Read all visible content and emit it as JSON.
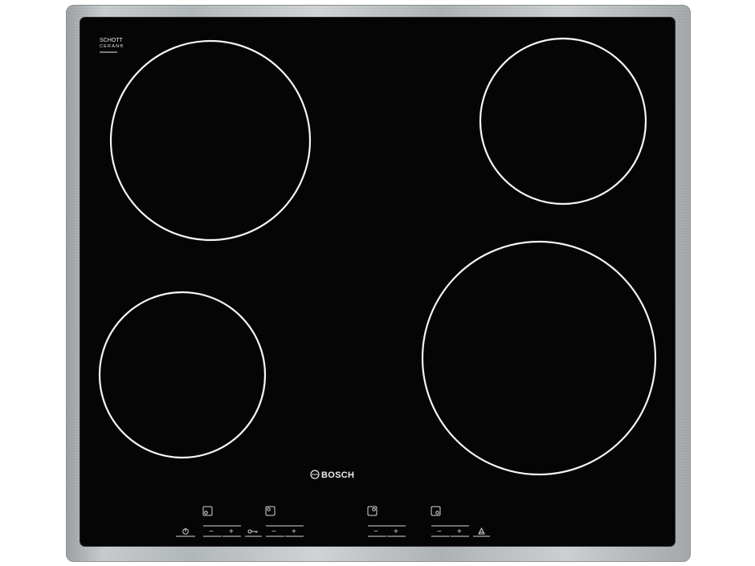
{
  "product": {
    "glass_brand_line1": "SCHOTT",
    "glass_brand_line2": "CERAN®",
    "maker_logo_text": "BOSCH"
  },
  "colors": {
    "glass": "#050505",
    "frame": "#b9bdc0",
    "markings": "#f4f4f4"
  },
  "controls": {
    "minus_label": "−",
    "plus_label": "+",
    "icons": [
      "power-icon",
      "zone-rear-left-icon",
      "lock-icon",
      "zone-front-left-icon",
      "zone-front-right-icon",
      "zone-rear-right-icon",
      "residual-heat-icon"
    ]
  }
}
